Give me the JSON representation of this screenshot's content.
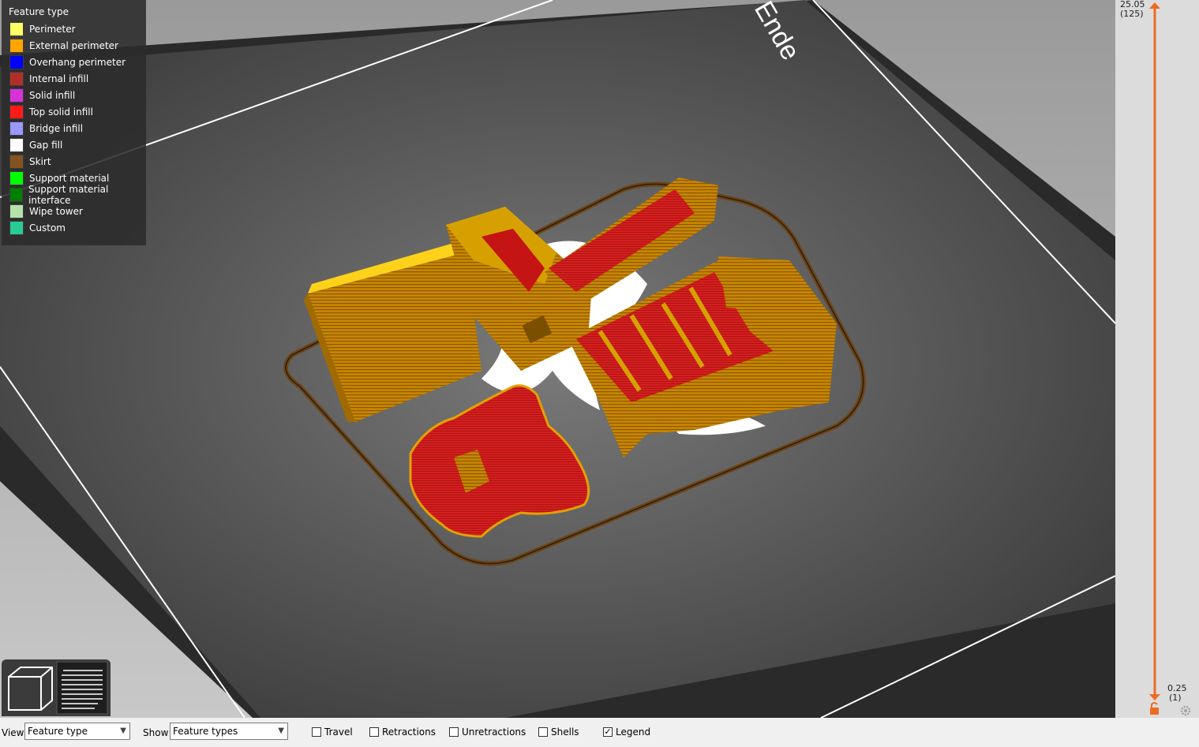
{
  "legend": {
    "title": "Feature type",
    "items": [
      {
        "label": "Perimeter",
        "color": "#ffff66"
      },
      {
        "label": "External perimeter",
        "color": "#ffa500"
      },
      {
        "label": "Overhang perimeter",
        "color": "#0000ff"
      },
      {
        "label": "Internal infill",
        "color": "#b03029"
      },
      {
        "label": "Solid infill",
        "color": "#d732d7"
      },
      {
        "label": "Top solid infill",
        "color": "#ff1a1a"
      },
      {
        "label": "Bridge infill",
        "color": "#9999ff"
      },
      {
        "label": "Gap fill",
        "color": "#ffffff"
      },
      {
        "label": "Skirt",
        "color": "#845321"
      },
      {
        "label": "Support material",
        "color": "#00ff00"
      },
      {
        "label": "Support material interface",
        "color": "#008000"
      },
      {
        "label": "Wipe tower",
        "color": "#b3e3ab"
      },
      {
        "label": "Custom",
        "color": "#28cc94"
      }
    ]
  },
  "bed": {
    "label": "Ende"
  },
  "layer_slider": {
    "top_height": "25.05",
    "top_layer": "(125)",
    "bottom_height": "0.25",
    "bottom_layer": "(1)",
    "accent": "#ed6b21"
  },
  "view_buttons": [
    {
      "icon": "cube-3d-view-icon"
    },
    {
      "icon": "layers-view-icon"
    }
  ],
  "toolbar": {
    "view_label": "View",
    "view_value": "Feature type",
    "show_label": "Show",
    "show_value": "Feature types",
    "checks": [
      {
        "label": "Travel",
        "checked": false
      },
      {
        "label": "Retractions",
        "checked": false
      },
      {
        "label": "Unretractions",
        "checked": false
      },
      {
        "label": "Shells",
        "checked": false
      },
      {
        "label": "Legend",
        "checked": true
      }
    ]
  }
}
